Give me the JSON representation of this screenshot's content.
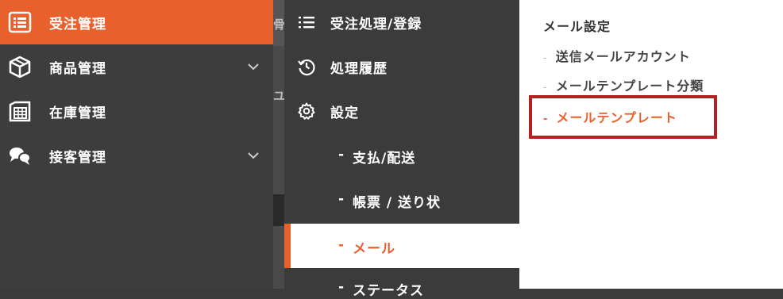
{
  "main_nav": [
    {
      "label": "受注管理",
      "icon": "order-list-icon",
      "active": true
    },
    {
      "label": "商品管理",
      "icon": "product-box-icon",
      "expandable": true
    },
    {
      "label": "在庫管理",
      "icon": "warehouse-icon"
    },
    {
      "label": "接客管理",
      "icon": "chat-bubbles-icon",
      "expandable": true
    }
  ],
  "sub_nav": [
    {
      "label": "受注処理/登録",
      "icon": "list-icon"
    },
    {
      "label": "処理履歴",
      "icon": "history-icon"
    },
    {
      "label": "設定",
      "icon": "gear-icon"
    }
  ],
  "settings_children": [
    {
      "label": "支払/配送"
    },
    {
      "label": "帳票 / 送り状"
    },
    {
      "label": "メール",
      "active": true
    },
    {
      "label": "ステータス"
    }
  ],
  "mail_panel": {
    "title": "メール設定",
    "items": [
      {
        "label": "送信メールアカウント"
      },
      {
        "label": "メールテンプレート分類"
      },
      {
        "label": "メールテンプレート",
        "active": true
      }
    ]
  },
  "colors": {
    "accent": "#e8602c",
    "sidebar": "#3d3d3d",
    "highlight": "#b22222"
  },
  "bg_fragments": {
    "top": "骨",
    "mid": "ユ"
  },
  "dash": "-"
}
